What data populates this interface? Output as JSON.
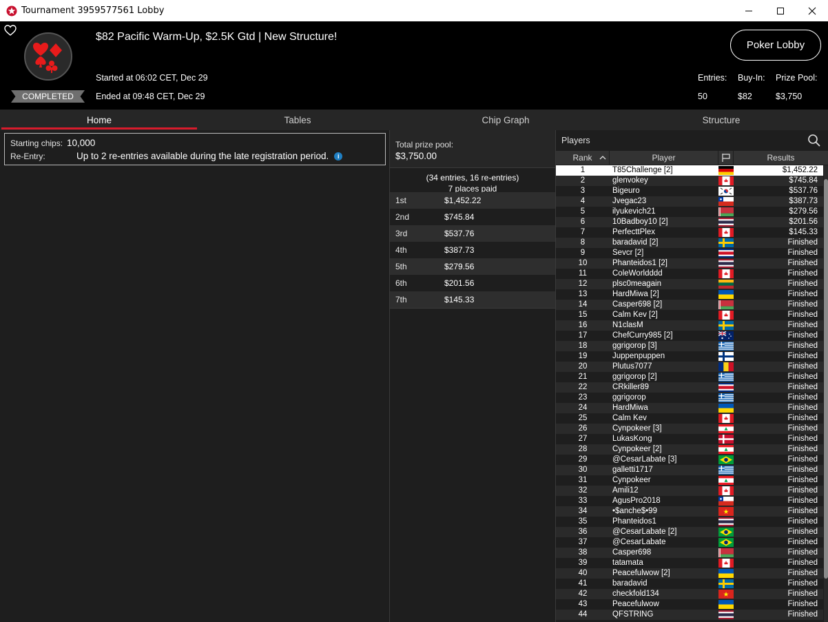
{
  "window": {
    "title": "Tournament 3959577561 Lobby",
    "minimize_icon": "minimize-icon",
    "maximize_icon": "maximize-icon",
    "close_icon": "close-icon"
  },
  "header": {
    "tournament_name": "$82 Pacific Warm-Up, $2.5K Gtd | New Structure!",
    "status_badge": "COMPLETED",
    "started": "Started at 06:02 CET, Dec 29",
    "ended": "Ended at 09:48 CET, Dec 29",
    "poker_lobby_button": "Poker Lobby",
    "entries_label": "Entries:",
    "entries_value": "50",
    "buyin_label": "Buy-In:",
    "buyin_value": "$82",
    "prizepool_label": "Prize Pool:",
    "prizepool_value": "$3,750"
  },
  "tabs": [
    "Home",
    "Tables",
    "Chip Graph",
    "Structure"
  ],
  "active_tab": "Home",
  "info": {
    "starting_chips_label": "Starting chips:",
    "starting_chips_value": "10,000",
    "reentry_label": "Re-Entry:",
    "reentry_value": "Up to 2 re-entries available during the late registration period.",
    "info_icon": "info-icon"
  },
  "prizes": {
    "total_label": "Total prize pool:",
    "total_value": "$3,750.00",
    "entries_text": "(34 entries, 16 re-entries)",
    "places_paid": "7 places paid",
    "rows": [
      {
        "place": "1st",
        "amount": "$1,452.22"
      },
      {
        "place": "2nd",
        "amount": "$745.84"
      },
      {
        "place": "3rd",
        "amount": "$537.76"
      },
      {
        "place": "4th",
        "amount": "$387.73"
      },
      {
        "place": "5th",
        "amount": "$279.56"
      },
      {
        "place": "6th",
        "amount": "$201.56"
      },
      {
        "place": "7th",
        "amount": "$145.33"
      }
    ]
  },
  "players": {
    "title": "Players",
    "columns": {
      "rank": "Rank",
      "player": "Player",
      "results": "Results"
    },
    "rows": [
      {
        "rank": "1",
        "name": "T85Challenge [2]",
        "flag": "de",
        "result": "$1,452.22"
      },
      {
        "rank": "2",
        "name": "glenvokey",
        "flag": "ca",
        "result": "$745.84"
      },
      {
        "rank": "3",
        "name": "Bigeuro",
        "flag": "kr",
        "result": "$537.76"
      },
      {
        "rank": "4",
        "name": "Jvegac23",
        "flag": "cl",
        "result": "$387.73"
      },
      {
        "rank": "5",
        "name": "ilyukevich21",
        "flag": "by",
        "result": "$279.56"
      },
      {
        "rank": "6",
        "name": "10Badboy10 [2]",
        "flag": "th",
        "result": "$201.56"
      },
      {
        "rank": "7",
        "name": "PerfecttPlex",
        "flag": "ca",
        "result": "$145.33"
      },
      {
        "rank": "8",
        "name": "baradavid [2]",
        "flag": "se",
        "result": "Finished"
      },
      {
        "rank": "9",
        "name": "Sevcr [2]",
        "flag": "cr",
        "result": "Finished"
      },
      {
        "rank": "10",
        "name": "Phanteidos1 [2]",
        "flag": "th",
        "result": "Finished"
      },
      {
        "rank": "11",
        "name": "ColeWorldddd",
        "flag": "ca",
        "result": "Finished"
      },
      {
        "rank": "12",
        "name": "plsc0meagain",
        "flag": "lt",
        "result": "Finished"
      },
      {
        "rank": "13",
        "name": "HardMiwa [2]",
        "flag": "ua",
        "result": "Finished"
      },
      {
        "rank": "14",
        "name": "Casper698 [2]",
        "flag": "by",
        "result": "Finished"
      },
      {
        "rank": "15",
        "name": "Calm Kev [2]",
        "flag": "ca",
        "result": "Finished"
      },
      {
        "rank": "16",
        "name": "N1clasM",
        "flag": "se",
        "result": "Finished"
      },
      {
        "rank": "17",
        "name": "ChefCurry985 [2]",
        "flag": "au",
        "result": "Finished"
      },
      {
        "rank": "18",
        "name": "ggrigorop [3]",
        "flag": "gr",
        "result": "Finished"
      },
      {
        "rank": "19",
        "name": "Juppenpuppen",
        "flag": "fi",
        "result": "Finished"
      },
      {
        "rank": "20",
        "name": "Plutus7077",
        "flag": "ro",
        "result": "Finished"
      },
      {
        "rank": "21",
        "name": "ggrigorop [2]",
        "flag": "gr",
        "result": "Finished"
      },
      {
        "rank": "22",
        "name": "CRkiller89",
        "flag": "cr",
        "result": "Finished"
      },
      {
        "rank": "23",
        "name": "ggrigorop",
        "flag": "gr",
        "result": "Finished"
      },
      {
        "rank": "24",
        "name": "HardMiwa",
        "flag": "ua",
        "result": "Finished"
      },
      {
        "rank": "25",
        "name": "Calm Kev",
        "flag": "ca",
        "result": "Finished"
      },
      {
        "rank": "26",
        "name": "Cynpokeer [3]",
        "flag": "lb",
        "result": "Finished"
      },
      {
        "rank": "27",
        "name": "LukasKong",
        "flag": "dk",
        "result": "Finished"
      },
      {
        "rank": "28",
        "name": "Cynpokeer [2]",
        "flag": "lb",
        "result": "Finished"
      },
      {
        "rank": "29",
        "name": "@CesarLabate [3]",
        "flag": "br",
        "result": "Finished"
      },
      {
        "rank": "30",
        "name": "galletti1717",
        "flag": "gr",
        "result": "Finished"
      },
      {
        "rank": "31",
        "name": "Cynpokeer",
        "flag": "lb",
        "result": "Finished"
      },
      {
        "rank": "32",
        "name": "Amili12",
        "flag": "ca",
        "result": "Finished"
      },
      {
        "rank": "33",
        "name": "AgusPro2018",
        "flag": "cl",
        "result": "Finished"
      },
      {
        "rank": "34",
        "name": "•$anche$•99",
        "flag": "vn",
        "result": "Finished"
      },
      {
        "rank": "35",
        "name": "Phanteidos1",
        "flag": "th",
        "result": "Finished"
      },
      {
        "rank": "36",
        "name": "@CesarLabate [2]",
        "flag": "br",
        "result": "Finished"
      },
      {
        "rank": "37",
        "name": "@CesarLabate",
        "flag": "br",
        "result": "Finished"
      },
      {
        "rank": "38",
        "name": "Casper698",
        "flag": "by",
        "result": "Finished"
      },
      {
        "rank": "39",
        "name": "tatamata",
        "flag": "ca",
        "result": "Finished"
      },
      {
        "rank": "40",
        "name": "Peacefulwow [2]",
        "flag": "ua",
        "result": "Finished"
      },
      {
        "rank": "41",
        "name": "baradavid",
        "flag": "se",
        "result": "Finished"
      },
      {
        "rank": "42",
        "name": "checkfold134",
        "flag": "vn",
        "result": "Finished"
      },
      {
        "rank": "43",
        "name": "Peacefulwow",
        "flag": "ua",
        "result": "Finished"
      },
      {
        "rank": "44",
        "name": "QFSTRING",
        "flag": "th",
        "result": "Finished"
      }
    ]
  }
}
